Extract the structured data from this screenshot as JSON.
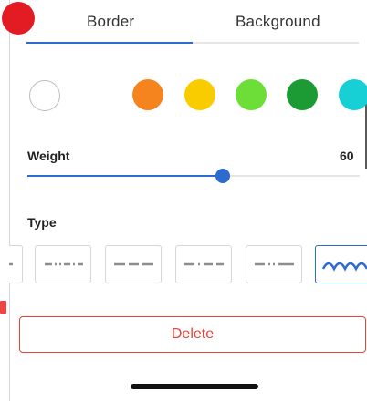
{
  "tabs": [
    {
      "label": "Border"
    },
    {
      "label": "Background"
    }
  ],
  "colors": [
    {
      "name": "white",
      "hex": "#ffffff"
    },
    {
      "name": "red",
      "hex": "#e31b23"
    },
    {
      "name": "orange",
      "hex": "#f5841f"
    },
    {
      "name": "yellow",
      "hex": "#f9cc00"
    },
    {
      "name": "light-green",
      "hex": "#6ddd38"
    },
    {
      "name": "dark-green",
      "hex": "#1c9b34"
    },
    {
      "name": "cyan",
      "hex": "#16d0d6"
    }
  ],
  "selected_color": "red",
  "weight": {
    "label": "Weight",
    "value": "60",
    "fraction": 0.56
  },
  "type": {
    "label": "Type",
    "styles": [
      "dash-dot-dot",
      "long-dash",
      "dash-dot",
      "dash-dot-dot-2",
      "wave"
    ],
    "selected": "wave"
  },
  "delete_label": "Delete",
  "accent_color": "#2d6bd1",
  "danger_color": "#e2453a"
}
